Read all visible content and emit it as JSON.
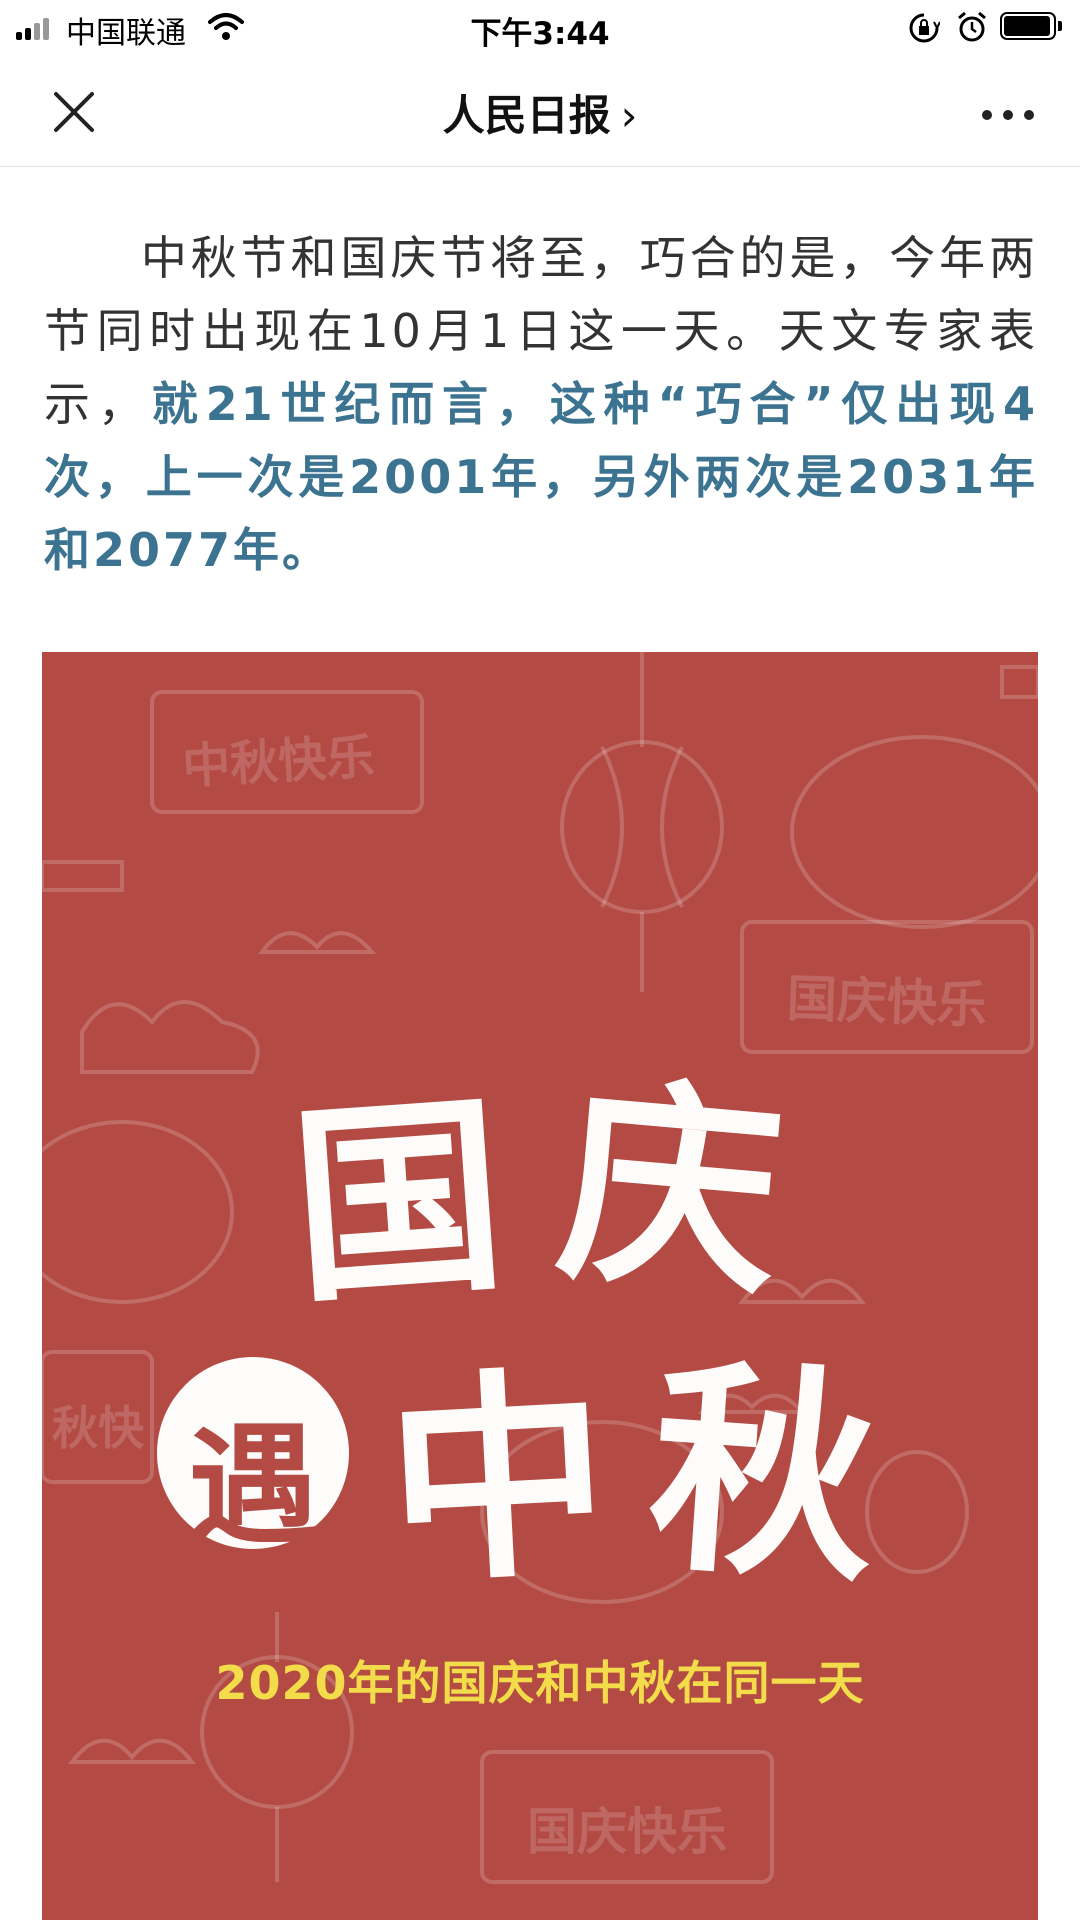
{
  "status_bar": {
    "carrier": "中国联通",
    "time": "下午3:44",
    "icons": [
      "signal-icon",
      "wifi-icon",
      "rotation-lock-icon",
      "alarm-icon",
      "battery-icon"
    ]
  },
  "nav": {
    "title": "人民日报",
    "chevron": "›",
    "icons": [
      "close-icon",
      "more-icon"
    ]
  },
  "article": {
    "plain": "中秋节和国庆节将至，巧合的是，今年两节同时出现在10月1日这一天。天文专家表示，",
    "highlight": "就21世纪而言，这种“巧合”仅出现4次，上一次是2001年，另外两次是2031年和2077年。"
  },
  "poster": {
    "char_guo": "国",
    "char_qing": "庆",
    "char_yu": "遇",
    "char_zhong": "中",
    "char_qiu": "秋",
    "subtitle": "2020年的国庆和中秋在同一天",
    "scroll_1": "中秋快乐",
    "scroll_2": "国庆快乐",
    "scroll_3": "秋快",
    "scroll_4": "国庆快乐",
    "colors": {
      "background": "#b34b44",
      "subtitle": "#f3dc4a",
      "highlight_text": "#3b7390"
    }
  }
}
